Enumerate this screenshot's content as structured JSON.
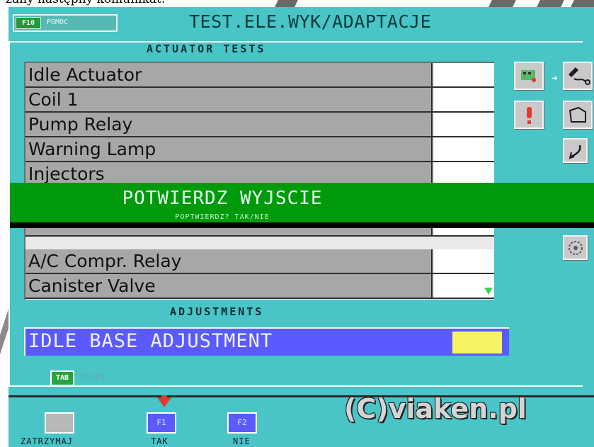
{
  "caption": {
    "text": "zany następny komunikat."
  },
  "header": {
    "help_key": "F10",
    "help_label": "POMOC",
    "title": "TEST.ELE.WYK/ADAPTACJE"
  },
  "actuators": {
    "title": "ACTUATOR TESTS",
    "items": [
      {
        "label": "Idle Actuator"
      },
      {
        "label": "Coil 1"
      },
      {
        "label": "Pump Relay"
      },
      {
        "label": "Warning Lamp"
      },
      {
        "label": "Injectors"
      },
      {
        "label": ""
      },
      {
        "label": ""
      },
      {
        "label": "A/C Compr. Relay"
      },
      {
        "label": "Canister Valve"
      }
    ]
  },
  "side_icons": [
    "car-diagnostic-icon",
    "arrow-right-icon",
    "connector-icon",
    "alert-icon",
    "hose-icon",
    "wrench-icon",
    "fan-icon"
  ],
  "dialog": {
    "title": "POTWIERDZ WYJSCIE",
    "subtitle": "POPTWIERDZ? TAK/NIE"
  },
  "adjustments": {
    "title": "ADJUSTMENTS",
    "items": [
      {
        "label": "IDLE BASE ADJUSTMENT"
      }
    ]
  },
  "tab": {
    "key": "TAB",
    "label": "ZMIEN"
  },
  "function_keys": [
    {
      "key": "",
      "label": "ZATRZYMAJ"
    },
    {
      "key": "F1",
      "label": "TAK"
    },
    {
      "key": "F2",
      "label": "NIE"
    }
  ],
  "watermark": "(C)viaken.pl",
  "colors": {
    "screen_bg": "#49c4c7",
    "list_label_bg": "#a7a7a7",
    "dialog_bg": "#009a0c",
    "selection_bg": "#5a5aff",
    "value_highlight": "#f7f463",
    "key_green": "#26a43f",
    "key_blue": "#5a5aff",
    "key_gray": "#b8b8b8"
  }
}
